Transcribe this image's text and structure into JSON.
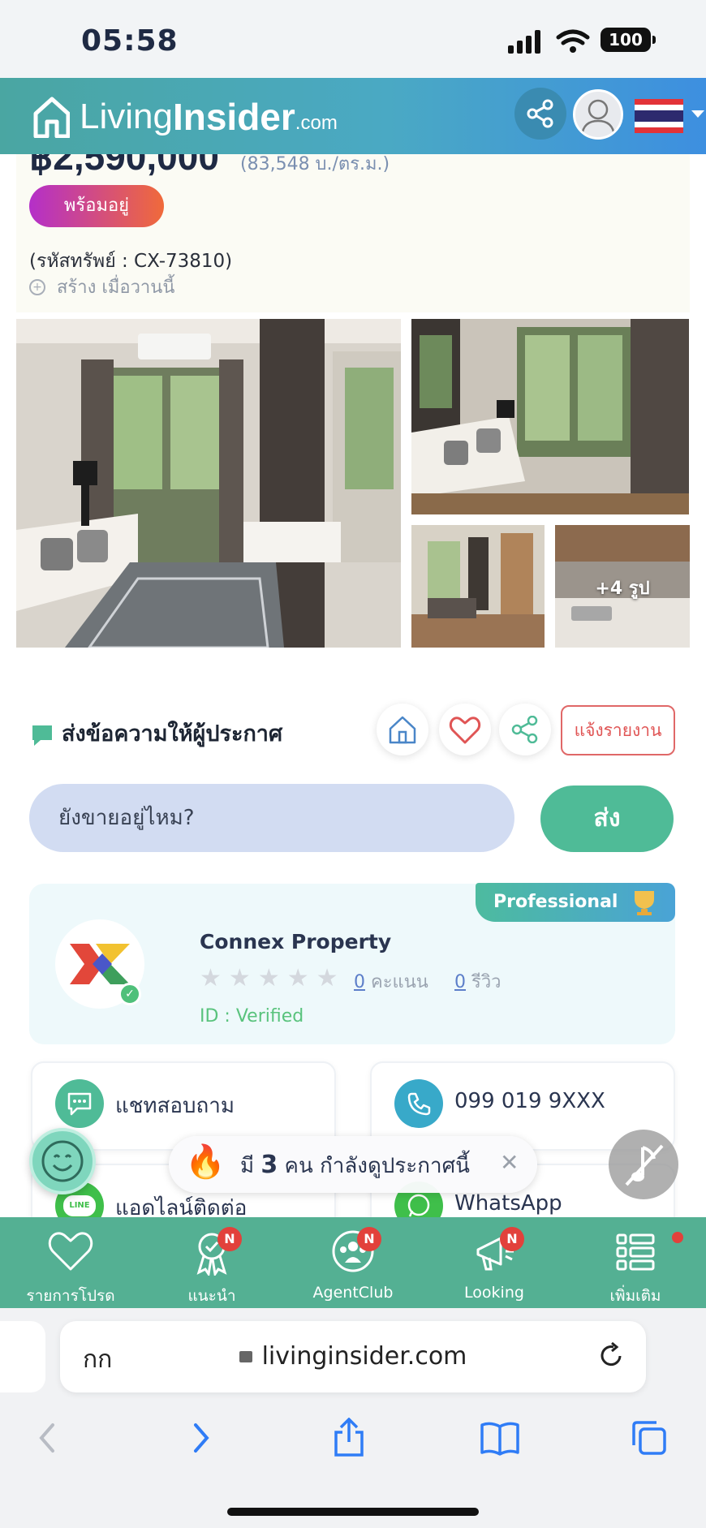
{
  "status_bar": {
    "time": "05:58",
    "battery": "100"
  },
  "header": {
    "logo_word1": "Living",
    "logo_word2": "Insider",
    "logo_suffix": ".com"
  },
  "listing": {
    "price": "฿2,590,000",
    "price_per_sqm": "(83,548 บ./ตร.ม.)",
    "status_badge": "พร้อมอยู่",
    "property_code": "(รหัสทรัพย์ : CX-73810)",
    "created": "สร้าง เมื่อวานนี้",
    "more_photos": "+4 รูป"
  },
  "message": {
    "title": "ส่งข้อความให้ผู้ประกาศ",
    "report_label": "แจ้งรายงาน",
    "input_placeholder": "ยังขายอยู่ไหม?",
    "send_label": "ส่ง"
  },
  "agent": {
    "badge": "Professional",
    "name": "Connex Property",
    "rating_count": "0",
    "rating_label": "คะแนน",
    "review_count": "0",
    "review_label": "รีวิว",
    "id_text": "ID : Verified",
    "stars": 0
  },
  "contact": {
    "chat_label": "แชทสอบถาม",
    "phone_label": "099 019 9XXX",
    "line_label": "แอดไลน์ติดต่อ",
    "whatsapp_label": "WhatsApp",
    "line_icon_text": "LINE"
  },
  "toast": {
    "prefix": "มี",
    "count": "3",
    "suffix": "คน กำลังดูประกาศนี้"
  },
  "bottom_nav": [
    {
      "label": "รายการโปรด",
      "badge": ""
    },
    {
      "label": "แนะนำ",
      "badge": "N"
    },
    {
      "label": "AgentClub",
      "badge": "N"
    },
    {
      "label": "Looking",
      "badge": "N"
    },
    {
      "label": "เพิ่มเติม",
      "badge": ""
    }
  ],
  "browser": {
    "aa": "กก",
    "url": "livinginsider.com"
  },
  "colors": {
    "brand_green": "#54b093",
    "header_blue": "#3d8fe0",
    "badge_red": "#e2413b"
  }
}
